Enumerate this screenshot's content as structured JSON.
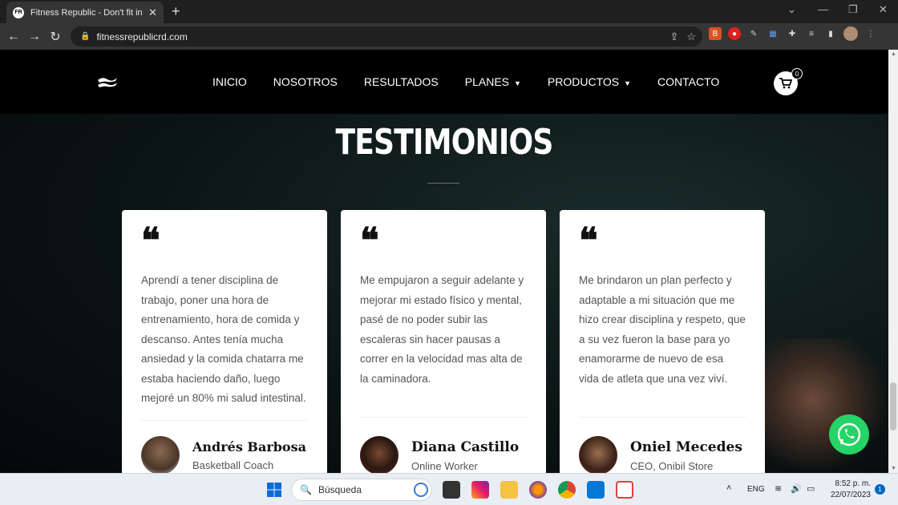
{
  "browser": {
    "tab_title": "Fitness Republic - Don't fit in - fit",
    "tab_favicon_text": "FR",
    "new_tab_label": "+",
    "url": "fitnessrepublicrd.com"
  },
  "site": {
    "menu": [
      {
        "label": "INICIO",
        "has_dropdown": false
      },
      {
        "label": "NOSOTROS",
        "has_dropdown": false
      },
      {
        "label": "RESULTADOS",
        "has_dropdown": false
      },
      {
        "label": "PLANES",
        "has_dropdown": true
      },
      {
        "label": "PRODUCTOS",
        "has_dropdown": true
      },
      {
        "label": "CONTACTO",
        "has_dropdown": false
      }
    ],
    "cart_count": "0",
    "heading": "TESTIMONIOS"
  },
  "testimonials": [
    {
      "text": "Aprendí a tener disciplina de trabajo, poner una hora de entrenamiento, hora de comida y descanso. Antes tenía mucha ansiedad y la comida chatarra me estaba haciendo daño, luego mejoré un 80% mi salud intestinal.",
      "name": "Andrés Barbosa",
      "role": "Basketball Coach"
    },
    {
      "text": "Me empujaron a seguir adelante y mejorar mi estado físico y mental, pasé de no poder subir las escaleras sin hacer pausas a correr en la velocidad mas alta de la caminadora.",
      "name": "Diana Castillo",
      "role": "Online Worker"
    },
    {
      "text": "Me brindaron un plan perfecto y adaptable a mi situación que me hizo crear disciplina y respeto, que a su vez fueron la base para yo enamorarme de nuevo de esa vida de atleta que una vez viví.",
      "name": "Oniel Mecedes",
      "role": "CEO, Onibil Store"
    }
  ],
  "taskbar": {
    "search_placeholder": "Búsqueda",
    "language": "ENG",
    "time": "8:52 p. m.",
    "date": "22/07/2023",
    "notifications": "1"
  }
}
